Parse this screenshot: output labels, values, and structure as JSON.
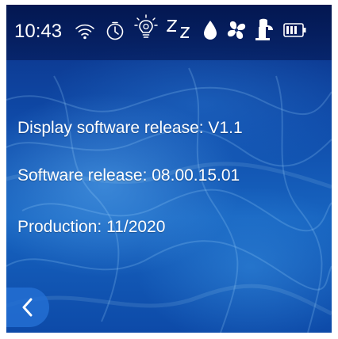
{
  "status_bar": {
    "time": "10:43",
    "icons": [
      "wifi-icon",
      "timer-icon",
      "light-bulb-icon",
      "sleep-icon",
      "water-drop-icon",
      "fan-icon",
      "fountain-icon",
      "battery-icon"
    ]
  },
  "info": {
    "display_software": "Display software release: V1.1",
    "software_release": "Software release: 08.00.15.01",
    "production": "Production: 11/2020"
  },
  "navigation": {
    "back_icon": "chevron-left-icon"
  },
  "colors": {
    "status_bar_bg": "#041a5c",
    "background_blue": "#1560bd",
    "text": "#ffffff"
  }
}
